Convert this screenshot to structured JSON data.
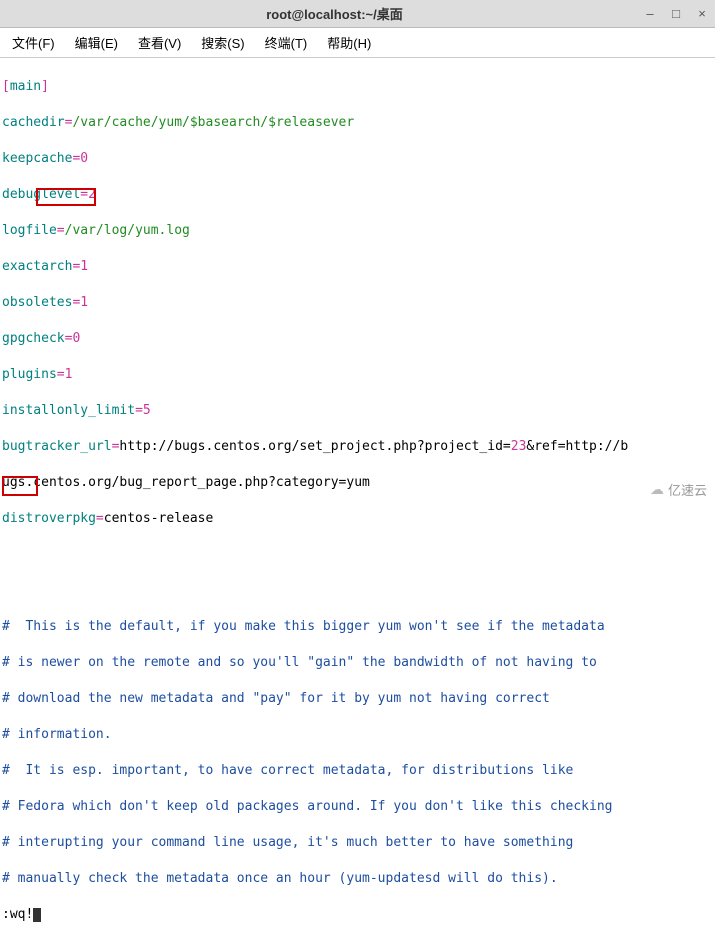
{
  "window": {
    "title": "root@localhost:~/桌面"
  },
  "menus": {
    "file": "文件(F)",
    "edit": "编辑(E)",
    "view": "查看(V)",
    "search": "搜索(S)",
    "terminal": "终端(T)",
    "help": "帮助(H)"
  },
  "config": {
    "section": "main",
    "lines": [
      {
        "key": "cachedir",
        "value": "/var/cache/yum/$basearch/$releasever"
      },
      {
        "key": "keepcache",
        "value": "0"
      },
      {
        "key": "debuglevel",
        "value": "2"
      },
      {
        "key": "logfile",
        "value": "/var/log/yum.log"
      },
      {
        "key": "exactarch",
        "value": "1"
      },
      {
        "key": "obsoletes",
        "value": "1"
      },
      {
        "key": "gpgcheck",
        "value": "0"
      },
      {
        "key": "plugins",
        "value": "1"
      },
      {
        "key": "installonly_limit",
        "value": "5"
      }
    ],
    "bugtracker_key": "bugtracker_url",
    "bugtracker_prefix": "http://bugs.centos.org/set_project.php?project_id=",
    "bugtracker_pid": "23",
    "bugtracker_suffix": "&ref=http://b",
    "bugtracker_line2": "ugs.centos.org/bug_report_page.php?category=yum",
    "distrover_key": "distroverpkg",
    "distrover_val": "centos-release"
  },
  "comments": {
    "c1": "#  This is the default, if you make this bigger yum won't see if the metadata",
    "c2": "# is newer on the remote and so you'll \"gain\" the bandwidth of not having to",
    "c3": "# download the new metadata and \"pay\" for it by yum not having correct",
    "c4": "# information.",
    "c5": "#  It is esp. important, to have correct metadata, for distributions like",
    "c6": "# Fedora which don't keep old packages around. If you don't like this checking",
    "c7": "# interupting your command line usage, it's much better to have something",
    "c8": "# manually check the metadata once an hour (yum-updatesd will do this)."
  },
  "cmdline": {
    "prefix": ":",
    "cmd": "wq!"
  },
  "watermark": "亿速云"
}
